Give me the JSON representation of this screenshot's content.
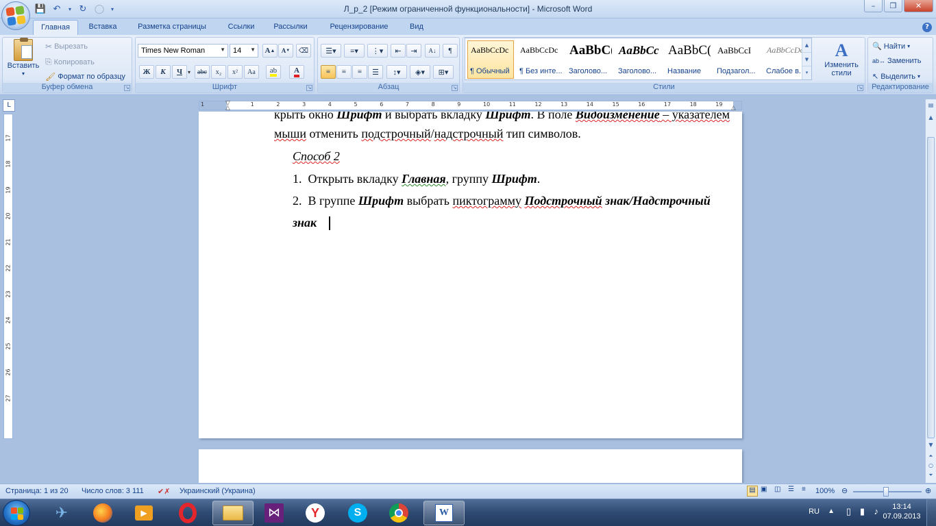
{
  "window": {
    "title": "Л_р_2 [Режим ограниченной функциональности] - Microsoft Word",
    "controls": [
      "–",
      "❐",
      "✕"
    ]
  },
  "tabs": [
    "Главная",
    "Вставка",
    "Разметка страницы",
    "Ссылки",
    "Рассылки",
    "Рецензирование",
    "Вид"
  ],
  "clipboard": {
    "paste": "Вставить",
    "cut": "Вырезать",
    "copy": "Копировать",
    "format_painter": "Формат по образцу",
    "label": "Буфер обмена"
  },
  "font": {
    "name": "Times New Roman",
    "size": "14",
    "label": "Шрифт",
    "buttons": [
      "Ж",
      "К",
      "Ч",
      "abc",
      "x₂",
      "x²",
      "Aa"
    ]
  },
  "paragraph": {
    "label": "Абзац"
  },
  "styles": {
    "label": "Стили",
    "items": [
      {
        "preview": "AaBbCcDc",
        "name": "¶ Обычный"
      },
      {
        "preview": "AaBbCcDc",
        "name": "¶ Без инте..."
      },
      {
        "preview": "AaBbC(",
        "name": "Заголово..."
      },
      {
        "preview": "AaBbCc",
        "name": "Заголово..."
      },
      {
        "preview": "AaBbC(",
        "name": "Название"
      },
      {
        "preview": "AaBbCcI",
        "name": "Подзагол..."
      },
      {
        "preview": "AaBbCcDc",
        "name": "Слабое в..."
      }
    ],
    "change": "Изменить стили"
  },
  "editing": {
    "label": "Редактирование",
    "find": "Найти",
    "replace": "Заменить",
    "select": "Выделить"
  },
  "ruler": {
    "h_numbers": [
      "1",
      "1",
      "2",
      "3",
      "4",
      "5",
      "6",
      "7",
      "8",
      "9",
      "10",
      "11",
      "12",
      "13",
      "14",
      "15",
      "16",
      "17",
      "18",
      "19"
    ],
    "v_numbers": [
      "17",
      "18",
      "19",
      "20",
      "21",
      "22",
      "23",
      "24",
      "25",
      "26",
      "27"
    ]
  },
  "document": {
    "line0": {
      "a": "крыть окно ",
      "b": "Шрифт",
      "c": " и выбрать вкладку ",
      "d": "Шрифт",
      "e": ". В поле ",
      "f": "Видоизменение",
      "g": " – указателем"
    },
    "line1": {
      "a": "мыши",
      "b": " отменить ",
      "c": "подстрочный",
      "d": "/",
      "e": "надстрочный",
      "f": " тип символов."
    },
    "heading": "Способ 2",
    "item1": {
      "num": "1.",
      "a": "Открыть вкладку ",
      "b": "Главная",
      "c": ", группу ",
      "d": "Шрифт",
      "e": "."
    },
    "item2": {
      "num": "2.",
      "a": "В группе ",
      "b": "Шрифт",
      "c": " выбрать ",
      "d": "пиктограмму",
      "e": " ",
      "f": "Подстрочный",
      "g": " знак/Надстрочный"
    },
    "item2b": "знак"
  },
  "status": {
    "page": "Страница: 1 из 20",
    "words": "Число слов: 3 111",
    "language": "Украинский (Украина)",
    "zoom": "100%"
  },
  "taskbar": {
    "lang": "RU",
    "time": "13:14",
    "date": "07.09.2013"
  },
  "colors": {
    "ribbon_text": "#15428b",
    "doc_bg": "#a9c0e0",
    "spell_error": "#d22",
    "grammar_error": "#2a8a2a"
  }
}
